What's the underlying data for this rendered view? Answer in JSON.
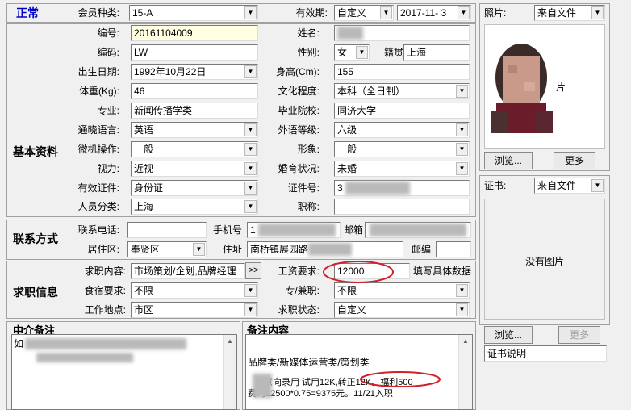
{
  "status": {
    "label": "正常",
    "color": "#0000cc"
  },
  "top": {
    "member_type_label": "会员种类:",
    "member_type_value": "15-A",
    "validity_label": "有效期:",
    "validity_mode": "自定义",
    "validity_date": "2017-11- 3"
  },
  "basic": {
    "section_title": "基本资料",
    "id_label": "编号:",
    "id_value": "20161104009",
    "code_label": "编码:",
    "code_value": "LW",
    "birth_label": "出生日期:",
    "birth_value": "1992年10月22日",
    "weight_label": "体重(Kg):",
    "weight_value": "46",
    "major_label": "专业:",
    "major_value": "新闻传播学类",
    "lang_label": "通晓语言:",
    "lang_value": "英语",
    "computer_label": "微机操作:",
    "computer_value": "一般",
    "vision_label": "视力:",
    "vision_value": "近视",
    "cert_label": "有效证件:",
    "cert_value": "身份证",
    "category_label": "人员分类:",
    "category_value": "上海",
    "name_label": "姓名:",
    "gender_label": "性别:",
    "gender_value": "女",
    "origin_label": "籍贯",
    "origin_value": "上海",
    "height_label": "身高(Cm):",
    "height_value": "155",
    "edu_label": "文化程度:",
    "edu_value": "本科（全日制）",
    "school_label": "毕业院校:",
    "school_value": "同济大学",
    "lang_level_label": "外语等级:",
    "lang_level_value": "六级",
    "image_label": "形象:",
    "image_value": "一般",
    "marital_label": "婚育状况:",
    "marital_value": "未婚",
    "cert_no_label": "证件号:",
    "cert_no_value": "3",
    "title_label": "职称:"
  },
  "contact": {
    "section_title": "联系方式",
    "phone_label": "联系电话:",
    "mobile_label": "手机号",
    "mobile_value": "1",
    "email_label": "邮箱",
    "district_label": "居住区:",
    "district_value": "奉贤区",
    "address_label": "住址",
    "address_value": "南桥镇展园路",
    "zip_label": "邮编"
  },
  "job": {
    "section_title": "求职信息",
    "content_label": "求职内容:",
    "content_value": "市场策划/企划,品牌经理",
    "more_button": ">>",
    "salary_label": "工资要求:",
    "salary_value": "12000",
    "salary_hint": "填写具体数据",
    "board_label": "食宿要求:",
    "board_value": "不限",
    "parttime_label": "专/兼职:",
    "parttime_value": "不限",
    "location_label": "工作地点:",
    "location_value": "市区",
    "jobstatus_label": "求职状态:",
    "jobstatus_value": "自定义"
  },
  "notes": {
    "agency_title": "中介备注",
    "agency_text": "如",
    "remark_title": "备注内容",
    "remark_line1": "品牌类/新媒体运营类/策划类",
    "remark_line2": "意向录用 试用12K,转正12K。福利500",
    "remark_line3": "费用12500*0.75=9375元。11/21入职"
  },
  "photo": {
    "label": "照片:",
    "source": "来自文件",
    "side_char": "片",
    "browse_button": "浏览...",
    "more_button": "更多"
  },
  "certificate": {
    "label": "证书:",
    "source": "来自文件",
    "empty_text": "没有图片",
    "browse_button": "浏览...",
    "more_button": "更多",
    "desc_value": "证书说明"
  },
  "colors": {
    "highlight_circle": "#d0202a",
    "status_blue": "#0000cc"
  }
}
